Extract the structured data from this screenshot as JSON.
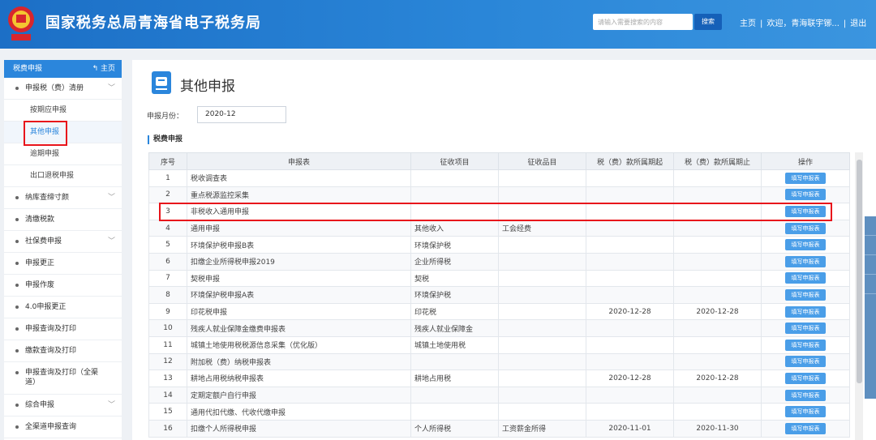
{
  "header": {
    "title": "国家税务总局青海省电子税务局",
    "search_placeholder": "请输入需要搜索的内容",
    "search_button": "搜索",
    "home_link": "主页",
    "welcome": "欢迎，青海联宇铘...",
    "logout": "退出"
  },
  "sidebar": {
    "header_label": "税费申报",
    "home_label": "主页",
    "items": [
      {
        "label": "申报税（费）清册",
        "type": "group",
        "expandable": true
      },
      {
        "label": "按期应申报",
        "type": "sub"
      },
      {
        "label": "其他申报",
        "type": "sub",
        "active": true
      },
      {
        "label": "逾期申报",
        "type": "sub"
      },
      {
        "label": "出口退税申报",
        "type": "sub"
      },
      {
        "label": "纳库查缔寸颜",
        "type": "group",
        "expandable": true
      },
      {
        "label": "清缴税款",
        "type": "group"
      },
      {
        "label": "社保费申报",
        "type": "group",
        "expandable": true
      },
      {
        "label": "申报更正",
        "type": "group"
      },
      {
        "label": "申报作废",
        "type": "group"
      },
      {
        "label": "4.0申报更正",
        "type": "group"
      },
      {
        "label": "申报查询及打印",
        "type": "group"
      },
      {
        "label": "缴款查询及打印",
        "type": "group"
      },
      {
        "label": "申报查询及打印（全渠道）",
        "type": "group",
        "tall": true
      },
      {
        "label": "综合申报",
        "type": "group",
        "expandable": true
      },
      {
        "label": "全渠道申报查询",
        "type": "group"
      }
    ]
  },
  "main": {
    "page_title": "其他申报",
    "month_label": "申报月份：",
    "month_value": "2020-12",
    "section_title": "税费申报",
    "table_headers": [
      "序号",
      "申报表",
      "征收项目",
      "征收品目",
      "税（费）款所属期起",
      "税（费）款所属期止",
      "操作"
    ],
    "action_label": "填写申报表",
    "rows": [
      {
        "no": "1",
        "form": "税收调查表",
        "item": "",
        "sub_item": "",
        "start": "",
        "end": ""
      },
      {
        "no": "2",
        "form": "重点税源监控采集",
        "item": "",
        "sub_item": "",
        "start": "",
        "end": ""
      },
      {
        "no": "3",
        "form": "非税收入通用申报",
        "item": "",
        "sub_item": "",
        "start": "",
        "end": ""
      },
      {
        "no": "4",
        "form": "通用申报",
        "item": "其他收入",
        "sub_item": "工会经费",
        "start": "",
        "end": ""
      },
      {
        "no": "5",
        "form": "环境保护税申报B表",
        "item": "环境保护税",
        "sub_item": "",
        "start": "",
        "end": ""
      },
      {
        "no": "6",
        "form": "扣缴企业所得税申报2019",
        "item": "企业所得税",
        "sub_item": "",
        "start": "",
        "end": ""
      },
      {
        "no": "7",
        "form": "契税申报",
        "item": "契税",
        "sub_item": "",
        "start": "",
        "end": ""
      },
      {
        "no": "8",
        "form": "环境保护税申报A表",
        "item": "环境保护税",
        "sub_item": "",
        "start": "",
        "end": ""
      },
      {
        "no": "9",
        "form": "印花税申报",
        "item": "印花税",
        "sub_item": "",
        "start": "2020-12-28",
        "end": "2020-12-28"
      },
      {
        "no": "10",
        "form": "残疾人就业保障金缴费申报表",
        "item": "残疾人就业保障金",
        "sub_item": "",
        "start": "",
        "end": ""
      },
      {
        "no": "11",
        "form": "城镇土地使用税税源信息采集（优化版）",
        "item": "城镇土地使用税",
        "sub_item": "",
        "start": "",
        "end": ""
      },
      {
        "no": "12",
        "form": "附加税（费）纳税申报表",
        "item": "",
        "sub_item": "",
        "start": "",
        "end": ""
      },
      {
        "no": "13",
        "form": "耕地占用税纳税申报表",
        "item": "耕地占用税",
        "sub_item": "",
        "start": "2020-12-28",
        "end": "2020-12-28"
      },
      {
        "no": "14",
        "form": "定期定额户自行申报",
        "item": "",
        "sub_item": "",
        "start": "",
        "end": ""
      },
      {
        "no": "15",
        "form": "通用代扣代缴、代收代缴申报",
        "item": "",
        "sub_item": "",
        "start": "",
        "end": ""
      },
      {
        "no": "16",
        "form": "扣缴个人所得税申报",
        "item": "个人所得税",
        "sub_item": "工资薪金所得",
        "start": "2020-11-01",
        "end": "2020-11-30"
      }
    ]
  },
  "colors": {
    "header_blue": "#2a86d8",
    "accent": "#2b86dc",
    "highlight_red": "#e8141b"
  }
}
